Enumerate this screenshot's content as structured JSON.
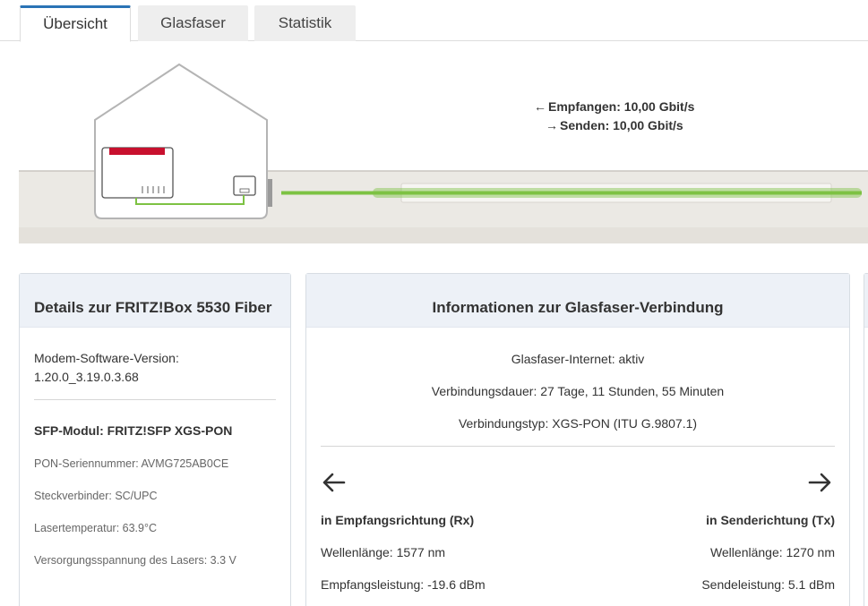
{
  "tabs": [
    {
      "label": "Übersicht",
      "active": true
    },
    {
      "label": "Glasfaser",
      "active": false
    },
    {
      "label": "Statistik",
      "active": false
    }
  ],
  "diagram": {
    "receive_label": "Empfangen: 10,00 Gbit/s",
    "send_label": "Senden: 10,00 Gbit/s",
    "receive_arrow": "←",
    "send_arrow": "→",
    "colors": {
      "fiber_line": "#7dc243",
      "router_accent": "#c8102e",
      "ground": "#ebe9e4"
    }
  },
  "details": {
    "title": "Details zur FRITZ!Box 5530 Fiber",
    "modem_label": "Modem-Software-Version:",
    "modem_value": "1.20.0_3.19.0.3.68",
    "sfp_title": "SFP-Modul: FRITZ!SFP XGS-PON",
    "serial": "PON-Seriennummer: AVMG725AB0CE",
    "connector": "Steckverbinder: SC/UPC",
    "laser_temp": "Lasertemperatur: 63.9°C",
    "supply_voltage": "Versorgungsspannung des Lasers: 3.3 V"
  },
  "fiber": {
    "title": "Informationen zur Glasfaser-Verbindung",
    "status": "Glasfaser-Internet: aktiv",
    "duration": "Verbindungsdauer: 27 Tage, 11 Stunden, 55 Minuten",
    "type": "Verbindungstyp: XGS-PON (ITU G.9807.1)",
    "rx": {
      "heading": "in Empfangsrichtung (Rx)",
      "wavelength": "Wellenlänge: 1577 nm",
      "power": "Empfangsleistung: -19.6 dBm"
    },
    "tx": {
      "heading": "in Senderichtung (Tx)",
      "wavelength": "Wellenlänge: 1270 nm",
      "power": "Sendeleistung: 5.1 dBm"
    }
  }
}
